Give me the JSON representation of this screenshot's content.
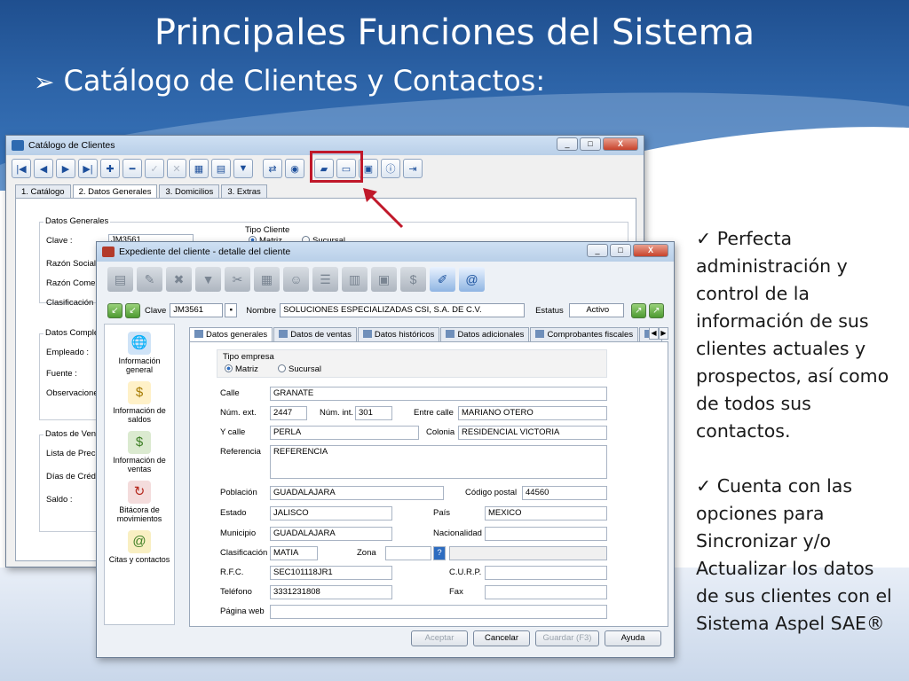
{
  "slide": {
    "title": "Principales Funciones del Sistema",
    "subtitle_marker": "➢",
    "subtitle": "Catálogo de Clientes y Contactos:"
  },
  "bullets": [
    {
      "mark": "✓",
      "text": "Perfecta administración y control de la información de sus clientes actuales y prospectos, así como de todos sus contactos."
    },
    {
      "mark": "✓",
      "text": "Cuenta con las opciones para Sincronizar y/o Actualizar los datos de sus clientes con el Sistema Aspel SAE®"
    }
  ],
  "catalog": {
    "title": "Catálogo de Clientes",
    "window_buttons": [
      "_",
      "□",
      "X"
    ],
    "toolbar_icons": [
      "first-icon",
      "prev-icon",
      "next-icon",
      "last-icon",
      "add-icon",
      "remove-icon",
      "check-icon",
      "cancel-icon",
      "export-icon",
      "print-icon",
      "filter-icon",
      "sync-icon",
      "update-icon",
      "folder-icon",
      "document-icon",
      "contacts-icon",
      "info-icon",
      "exit-icon"
    ],
    "tabs": [
      "1. Catálogo",
      "2. Datos Generales",
      "3. Domicilios",
      "3. Extras"
    ],
    "groups": {
      "datos_generales": "Datos Generales",
      "datos_complementarios": "Datos Compleme",
      "datos_ventas": "Datos de Ventas"
    },
    "fields": {
      "clave_label": "Clave :",
      "clave_value": "JM3561",
      "razon_label": "Razón Social :",
      "razon_comercial_label": "Razón Comerci",
      "clasificacion_label": "Clasificación :",
      "tipo_cliente_label": "Tipo Cliente",
      "matriz": "Matriz",
      "sucursal": "Sucursal",
      "empleado_label": "Empleado :",
      "fuente_label": "Fuente :",
      "observaciones_label": "Observacione",
      "lista_label": "Lista de Precios",
      "dias_label": "Días de Crédit",
      "saldo_label": "Saldo :"
    }
  },
  "expediente": {
    "title": "Expediente del cliente - detalle del cliente",
    "window_buttons": [
      "_",
      "□",
      "X"
    ],
    "clave_label": "Clave",
    "clave_value": "JM3561",
    "nombre_label": "Nombre",
    "nombre_value": "SOLUCIONES ESPECIALIZADAS CSI, S.A. DE C.V.",
    "estatus_label": "Estatus",
    "estatus_value": "Activo",
    "sidebar": [
      {
        "icon": "globe-icon",
        "glyph": "🌐",
        "label": "Información general"
      },
      {
        "icon": "money-icon",
        "glyph": "$",
        "label": "Información de saldos"
      },
      {
        "icon": "sales-icon",
        "glyph": "$",
        "label": "Información de ventas"
      },
      {
        "icon": "log-icon",
        "glyph": "↻",
        "label": "Bitácora de movimientos"
      },
      {
        "icon": "calendar-icon",
        "glyph": "@",
        "label": "Citas y contactos"
      }
    ],
    "tabs": [
      "Datos generales",
      "Datos de ventas",
      "Datos históricos",
      "Datos adicionales",
      "Comprobantes fiscales",
      "Da"
    ],
    "form": {
      "tipo_empresa_label": "Tipo empresa",
      "matriz": "Matriz",
      "sucursal": "Sucursal",
      "calle_label": "Calle",
      "calle_value": "GRANATE",
      "num_ext_label": "Núm. ext.",
      "num_ext_value": "2447",
      "num_int_label": "Núm. int.",
      "num_int_value": "301",
      "entre_calle_label": "Entre calle",
      "entre_calle_value": "MARIANO OTERO",
      "y_calle_label": "Y calle",
      "y_calle_value": "PERLA",
      "colonia_label": "Colonia",
      "colonia_value": "RESIDENCIAL VICTORIA",
      "referencia_label": "Referencia",
      "referencia_value": "REFERENCIA",
      "poblacion_label": "Población",
      "poblacion_value": "GUADALAJARA",
      "cp_label": "Código postal",
      "cp_value": "44560",
      "estado_label": "Estado",
      "estado_value": "JALISCO",
      "pais_label": "País",
      "pais_value": "MEXICO",
      "municipio_label": "Municipio",
      "municipio_value": "GUADALAJARA",
      "nacionalidad_label": "Nacionalidad",
      "clasificacion_label": "Clasificación",
      "clasificacion_value": "MATIA",
      "zona_label": "Zona",
      "rfc_label": "R.F.C.",
      "rfc_value": "SEC101118JR1",
      "curp_label": "C.U.R.P.",
      "telefono_label": "Teléfono",
      "telefono_value": "3331231808",
      "fax_label": "Fax",
      "pagina_label": "Página web"
    },
    "buttons": {
      "aceptar": "Aceptar",
      "cancelar": "Cancelar",
      "guardar": "Guardar (F3)",
      "ayuda": "Ayuda"
    }
  }
}
